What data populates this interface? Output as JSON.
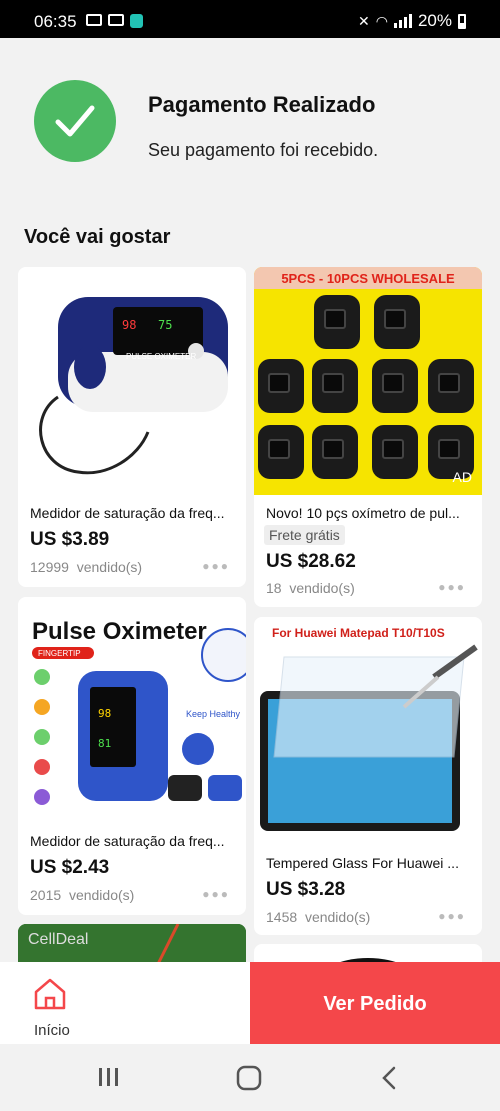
{
  "status_bar": {
    "time": "06:35",
    "battery": "20%"
  },
  "payment": {
    "title": "Pagamento Realizado",
    "subtitle": "Seu pagamento foi recebido."
  },
  "section_title": "Você vai gostar",
  "products": [
    {
      "name": "Medidor de saturação da freq...",
      "price": "US $3.89",
      "sold_count": "12999",
      "sold_label": "vendido(s)",
      "image": "pulse-oximeter-blue",
      "image_text": "PULSE OXIMETER"
    },
    {
      "name": "Novo! 10 pçs oxímetro de pul...",
      "badge": "Frete grátis",
      "price": "US $28.62",
      "sold_count": "18",
      "sold_label": "vendido(s)",
      "image": "oximeters-10pcs",
      "banner": "5PCS - 10PCS WHOLESALE",
      "ad": "AD"
    },
    {
      "name": "Medidor de saturação da freq...",
      "price": "US $2.43",
      "sold_count": "2015",
      "sold_label": "vendido(s)",
      "image": "pulse-oximeter-ad",
      "image_title": "Pulse Oximeter",
      "image_tag": "FINGERTIP",
      "image_text": "Keep Healthy"
    },
    {
      "name": "Tempered Glass For Huawei ...",
      "price": "US $3.28",
      "sold_count": "1458",
      "sold_label": "vendido(s)",
      "image": "tablet-glass",
      "image_title": "For Huawei Matepad T10/T10S"
    },
    {
      "image": "celldeal-partial",
      "image_title": "CellDeal"
    },
    {
      "image": "round-device-partial"
    }
  ],
  "bottom_bar": {
    "home_label": "Início",
    "order_button": "Ver Pedido"
  },
  "colors": {
    "accent": "#f4474a",
    "success": "#4cb963"
  },
  "icons": [
    "check-icon",
    "home-icon",
    "recent-apps-icon",
    "home-nav-icon",
    "back-icon"
  ]
}
